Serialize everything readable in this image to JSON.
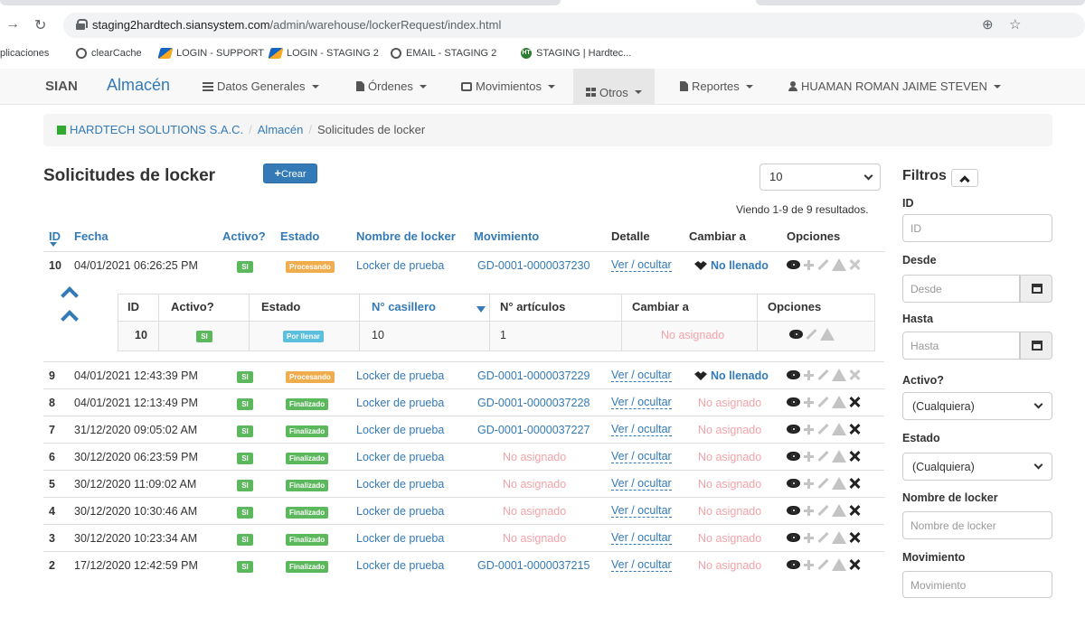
{
  "browser": {
    "url_host": "staging2hardtech.siansystem.com",
    "url_path": "/admin/warehouse/lockerRequest/index.html",
    "bookmarks": [
      "plicaciones",
      "clearCache",
      "LOGIN - SUPPORT",
      "LOGIN - STAGING 2",
      "EMAIL - STAGING 2",
      "STAGING | Hardtec..."
    ]
  },
  "nav": {
    "brand": "SIAN",
    "module": "Almacén",
    "items": [
      "Datos Generales",
      "Órdenes",
      "Movimientos",
      "Otros",
      "Reportes"
    ],
    "user": "HUAMAN ROMAN JAIME STEVEN"
  },
  "breadcrumb": {
    "company": "HARDTECH SOLUTIONS S.A.C.",
    "module": "Almacén",
    "current": "Solicitudes de locker"
  },
  "page": {
    "title": "Solicitudes de locker",
    "create_label": "Crear",
    "page_size": "10",
    "summary": "Viendo 1-9 de 9 resultados."
  },
  "table": {
    "headers": {
      "id": "ID",
      "fecha": "Fecha",
      "activo": "Activo?",
      "estado": "Estado",
      "locker": "Nombre de locker",
      "movimiento": "Movimiento",
      "detalle": "Detalle",
      "cambiar": "Cambiar a",
      "opciones": "Opciones"
    },
    "rows": [
      {
        "id": "10",
        "fecha": "04/01/2021 06:26:25 PM",
        "activo": "SI",
        "estado": "Procesando",
        "locker": "Locker de prueba",
        "movimiento": "GD-0001-0000037230",
        "detalle": "Ver / ocultar",
        "cambiar": "No llenado"
      },
      {
        "id": "9",
        "fecha": "04/01/2021 12:43:39 PM",
        "activo": "SI",
        "estado": "Procesando",
        "locker": "Locker de prueba",
        "movimiento": "GD-0001-0000037229",
        "detalle": "Ver / ocultar",
        "cambiar": "No llenado"
      },
      {
        "id": "8",
        "fecha": "04/01/2021 12:13:49 PM",
        "activo": "SI",
        "estado": "Finalizado",
        "locker": "Locker de prueba",
        "movimiento": "GD-0001-0000037228",
        "detalle": "Ver / ocultar",
        "cambiar": "No asignado"
      },
      {
        "id": "7",
        "fecha": "31/12/2020 09:05:02 AM",
        "activo": "SI",
        "estado": "Finalizado",
        "locker": "Locker de prueba",
        "movimiento": "GD-0001-0000037227",
        "detalle": "Ver / ocultar",
        "cambiar": "No asignado"
      },
      {
        "id": "6",
        "fecha": "30/12/2020 06:23:59 PM",
        "activo": "SI",
        "estado": "Finalizado",
        "locker": "Locker de prueba",
        "movimiento": "No asignado",
        "detalle": "Ver / ocultar",
        "cambiar": "No asignado"
      },
      {
        "id": "5",
        "fecha": "30/12/2020 11:09:02 AM",
        "activo": "SI",
        "estado": "Finalizado",
        "locker": "Locker de prueba",
        "movimiento": "No asignado",
        "detalle": "Ver / ocultar",
        "cambiar": "No asignado"
      },
      {
        "id": "4",
        "fecha": "30/12/2020 10:30:46 AM",
        "activo": "SI",
        "estado": "Finalizado",
        "locker": "Locker de prueba",
        "movimiento": "No asignado",
        "detalle": "Ver / ocultar",
        "cambiar": "No asignado"
      },
      {
        "id": "3",
        "fecha": "30/12/2020 10:23:34 AM",
        "activo": "SI",
        "estado": "Finalizado",
        "locker": "Locker de prueba",
        "movimiento": "No asignado",
        "detalle": "Ver / ocultar",
        "cambiar": "No asignado"
      },
      {
        "id": "2",
        "fecha": "17/12/2020 12:42:59 PM",
        "activo": "SI",
        "estado": "Finalizado",
        "locker": "Locker de prueba",
        "movimiento": "GD-0001-0000037215",
        "detalle": "Ver / ocultar",
        "cambiar": "No asignado"
      }
    ]
  },
  "subtable": {
    "headers": {
      "id": "ID",
      "activo": "Activo?",
      "estado": "Estado",
      "casillero": "N° casillero",
      "articulos": "N° artículos",
      "cambiar": "Cambiar a",
      "opciones": "Opciones"
    },
    "row": {
      "id": "10",
      "activo": "SI",
      "estado": "Por llenar",
      "casillero": "10",
      "articulos": "1",
      "cambiar": "No asignado"
    }
  },
  "filters": {
    "title": "Filtros",
    "id_label": "ID",
    "id_placeholder": "ID",
    "desde_label": "Desde",
    "desde_placeholder": "Desde",
    "hasta_label": "Hasta",
    "hasta_placeholder": "Hasta",
    "activo_label": "Activo?",
    "activo_value": "(Cualquiera)",
    "estado_label": "Estado",
    "estado_value": "(Cualquiera)",
    "locker_label": "Nombre de locker",
    "locker_placeholder": "Nombre de locker",
    "mov_label": "Movimiento",
    "mov_placeholder": "Movimiento"
  },
  "colors": {
    "link": "#337ab7",
    "success": "#5cb85c",
    "warning": "#f0ad4e",
    "info": "#5bc0de",
    "muted_red": "#f3a3a9"
  }
}
